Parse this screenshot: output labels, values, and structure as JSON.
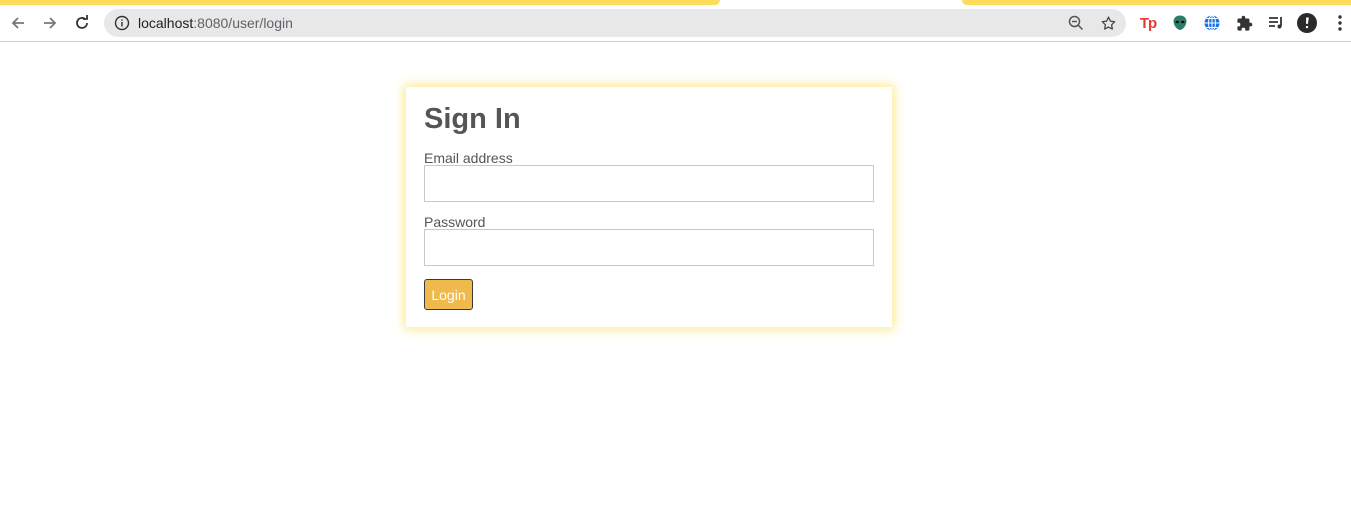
{
  "browser": {
    "url_host": "localhost",
    "url_rest": ":8080/user/login",
    "icons": {
      "back": "arrow-left-icon",
      "forward": "arrow-right-icon",
      "reload": "reload-icon",
      "info": "info-icon",
      "zoom": "zoom-out-icon",
      "bookmark": "star-icon",
      "extensions": [
        "tp-extension-icon",
        "alien-extension-icon",
        "globe-extension-icon",
        "puzzle-icon",
        "media-queue-icon",
        "profile-avatar-icon",
        "more-vert-icon"
      ]
    },
    "ext_tp_label": "Tp"
  },
  "login": {
    "title": "Sign In",
    "email_label": "Email address",
    "email_value": "",
    "password_label": "Password",
    "password_value": "",
    "submit_label": "Login"
  },
  "colors": {
    "tab_accent": "#fddb5b",
    "card_glow": "#fce25a",
    "button_bg": "#f0b94c"
  }
}
